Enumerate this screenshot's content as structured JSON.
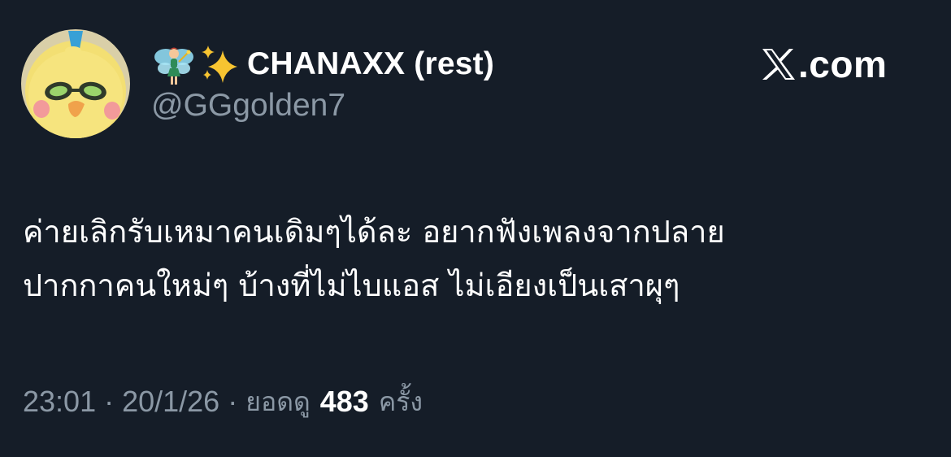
{
  "author": {
    "avatar_icon": "yellow-chick-avatar",
    "name_emojis": [
      "fairy-icon",
      "sparkles-icon"
    ],
    "display_name": "CHANAXX (rest)",
    "handle": "@GGgolden7"
  },
  "brand": {
    "icon": "x-logo-icon",
    "text": ".com"
  },
  "tweet": {
    "lines": [
      "ค่ายเลิกรับเหมาคนเดิมๆได้ละ อยากฟังเพลงจากปลาย",
      "ปากกาคนใหม่ๆ บ้างที่ไม่ไบแอส ไม่เอียงเป็นเสาผุๆ"
    ]
  },
  "meta": {
    "time": "23:01",
    "date": "20/1/26",
    "separator": "·",
    "views_label": "ยอดดู",
    "views_count": "483",
    "views_unit": "ครั้ง"
  },
  "colors": {
    "background": "#151d28",
    "primary_text": "#ffffff",
    "secondary_text": "#8b98a5"
  }
}
